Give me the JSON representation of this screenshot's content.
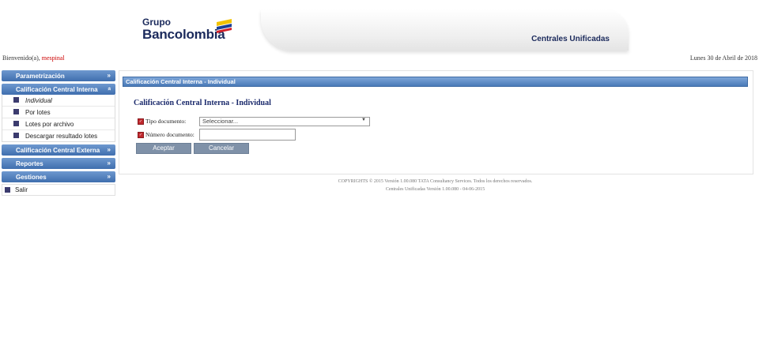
{
  "header": {
    "logo_grupo": "Grupo",
    "logo_bank": "Bancolombia",
    "banner_title": "Centrales Unificadas"
  },
  "welcome": {
    "prefix": "Bienvenido(a),",
    "user": "mespinal"
  },
  "date": "Lunes 30 de Abril de 2018",
  "sidebar": {
    "sections": [
      {
        "label": "Parametrización",
        "icon": "chevron-down-icon"
      },
      {
        "label": "Calificación Central Interna",
        "icon": "chevron-up-icon",
        "items": [
          "Individual",
          "Por lotes",
          "Lotes por archivo",
          "Descargar resultado lotes"
        ]
      },
      {
        "label": "Calificación Central Externa",
        "icon": "chevron-down-icon"
      },
      {
        "label": "Reportes",
        "icon": "chevron-down-icon"
      },
      {
        "label": "Gestiones",
        "icon": "chevron-down-icon"
      }
    ],
    "exit_label": "Salir"
  },
  "main": {
    "panel_title": "Calificación Central Interna - Individual",
    "form_title": "Calificación Central Interna - Individual",
    "tipo_label": "Tipo documento:",
    "tipo_value": "Seleccionar...",
    "numero_label": "Número documento:",
    "numero_value": "",
    "accept_label": "Aceptar",
    "cancel_label": "Cancelar"
  },
  "footer": {
    "copyright": "COPYRIGHTS © 2015 Versión 1.00.080 TATA Consultancy Services. Todos los derechos reservados.",
    "version": "Centrales Unificadas Versión 1.00.080 - 04-06-2015"
  },
  "colors": {
    "brand_navy": "#1b2a5c",
    "menu_blue": "#4a7ab8",
    "required_red": "#c0282d",
    "button": "#7f91a8"
  }
}
